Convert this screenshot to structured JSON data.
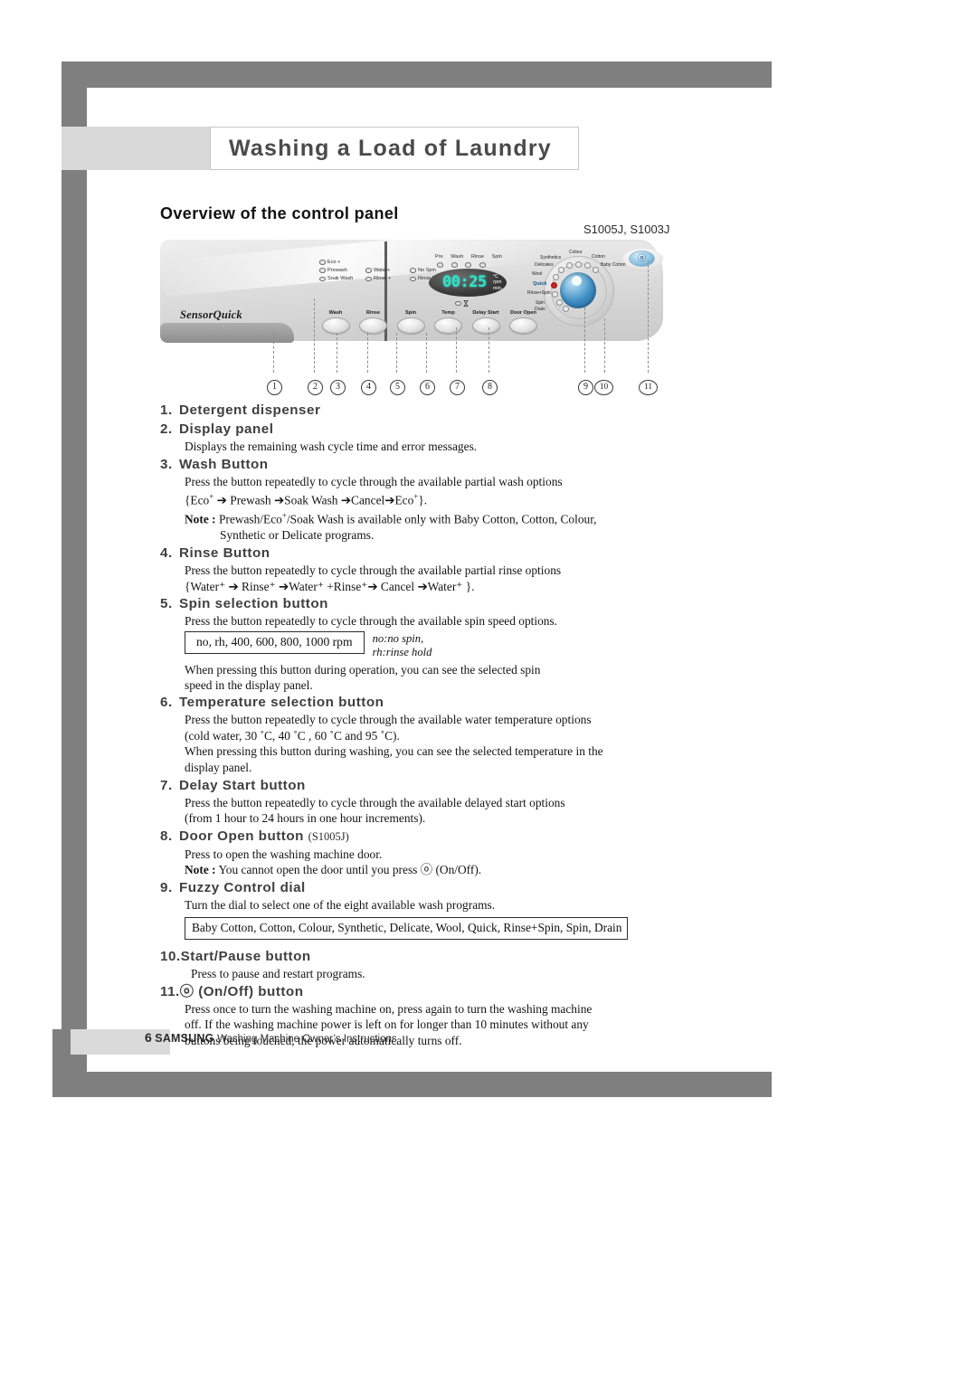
{
  "page": {
    "chapter_title": "Washing a Load of Laundry",
    "section_title": "Overview of the control panel",
    "model_label": "S1005J, S1003J",
    "footer": {
      "page_number": "6",
      "brand": "SAMSUNG",
      "text": "Washing Machine Owner’s Instructions"
    }
  },
  "control_panel": {
    "brand_mark": "SensorQuick",
    "indicator_lamps": [
      [
        "Eco +"
      ],
      [
        "Prewash",
        "Water+",
        "No Spin"
      ],
      [
        "Soak Wash",
        "Rinse +",
        "Rinse Hold"
      ]
    ],
    "display": {
      "progress_labels": [
        "Pre",
        "Wash",
        "Rinse",
        "Spin"
      ],
      "value": "00:25",
      "units": [
        "°C",
        "rpm",
        "min."
      ]
    },
    "buttons": [
      "Wash",
      "Rinse",
      "Spin",
      "Temp",
      "Delay Start",
      "Door Open"
    ],
    "dial_labels": [
      "Colour",
      "Synthetics",
      "Cotton",
      "Delicates",
      "Baby Cotton",
      "Wool",
      "Quick",
      "Rinse+Spin",
      "Spin",
      "Drain"
    ],
    "power_symbol": "ⓞ",
    "callouts": [
      "1",
      "2",
      "3",
      "4",
      "5",
      "6",
      "7",
      "8",
      "9",
      "10",
      "11"
    ]
  },
  "items": [
    {
      "num": "1.",
      "title": "Detergent dispenser"
    },
    {
      "num": "2.",
      "title": "Display panel",
      "body1": "Displays the remaining wash cycle time and error messages."
    },
    {
      "num": "3.",
      "title": "Wash Button",
      "body1": "Press the button repeatedly to cycle through the available partial wash options",
      "body2_pre": "{Eco",
      "body2_mid": " ➔ Prewash ➔Soak Wash ➔Cancel➔Eco",
      "body2_post": "}.",
      "note_label": "Note :",
      "note_line1_a": "Prewash/Eco",
      "note_line1_b": "/Soak Wash is available only with Baby Cotton, Cotton, Colour,",
      "note_line2": "Synthetic or Delicate programs."
    },
    {
      "num": "4.",
      "title": "Rinse Button",
      "body1": "Press the button repeatedly to cycle through the available partial rinse options",
      "body2": "{Water⁺ ➔ Rinse⁺ ➔Water⁺ +Rinse⁺➔ Cancel ➔Water⁺ }."
    },
    {
      "num": "5.",
      "title": "Spin selection button",
      "body1": "Press the button repeatedly to cycle through the available spin speed options.",
      "box": "no, rh, 400, 600, 800, 1000 rpm",
      "legend1": "no:no spin,",
      "legend2": "rh:rinse hold",
      "body2": "When pressing this button during operation,  you can see the selected spin",
      "body3": "speed in the display panel."
    },
    {
      "num": "6.",
      "title": "Temperature selection button",
      "body1": "Press the button repeatedly to cycle through the available water temperature options",
      "body2": "(cold water, 30 ˚C, 40 ˚C , 60 ˚C and 95 ˚C).",
      "body3": "When pressing this button during washing, you can see the selected temperature in the",
      "body4": "display panel."
    },
    {
      "num": "7.",
      "title": "Delay Start button",
      "body1": "Press the button repeatedly to cycle through the available delayed start options",
      "body2": "(from 1 hour to 24 hours in one hour increments)."
    },
    {
      "num": "8.",
      "title": "Door Open button",
      "suffix": "(S1005J)",
      "body1": "Press to open the washing machine door.",
      "note_label": "Note :",
      "note_text": "You cannot open the door until you press ⓞ (On/Off)."
    },
    {
      "num": "9.",
      "title": "Fuzzy Control dial",
      "body1": "Turn the dial to select one of the eight available wash programs.",
      "box": "Baby Cotton, Cotton, Colour, Synthetic, Delicate, Wool, Quick, Rinse+Spin, Spin, Drain"
    },
    {
      "num": "10.",
      "title": "Start/Pause button",
      "body1": "Press to pause and restart programs."
    },
    {
      "num": "11.",
      "title": "ⓞ (On/Off) button",
      "body1": "Press once to turn the washing machine on, press again to turn the washing machine",
      "body2": "off. If the washing machine power is left on for longer than 10 minutes without any",
      "body3": "buttons being touched, the power automatically turns off."
    }
  ]
}
